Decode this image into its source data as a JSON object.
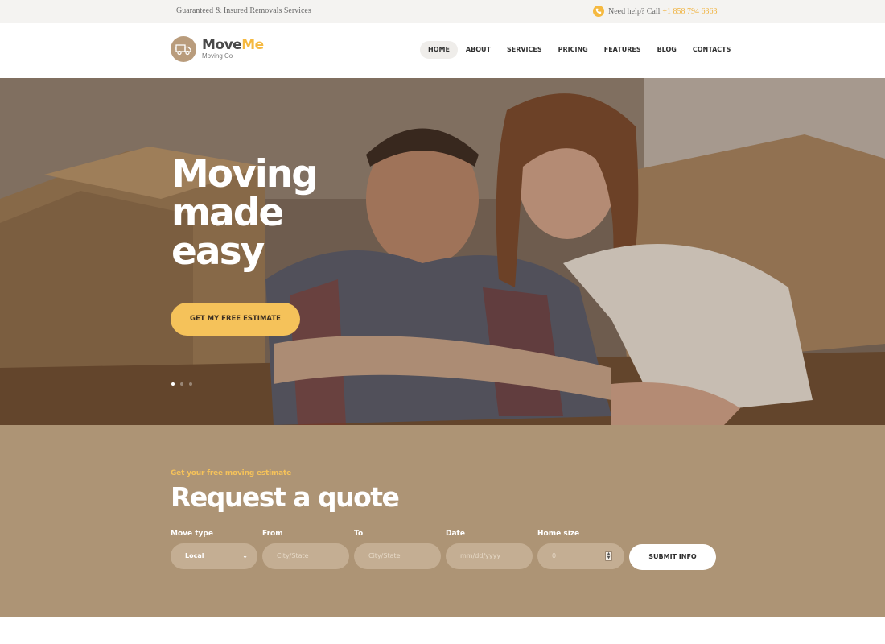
{
  "topbar": {
    "tagline": "Guaranteed & Insured Removals Services",
    "help_label": "Need help? Call",
    "phone": "+1 858 794 6363"
  },
  "brand": {
    "name_part1": "Move",
    "name_part2": "Me",
    "subtitle": "Moving Co"
  },
  "nav": {
    "items": [
      {
        "label": "HOME",
        "active": true
      },
      {
        "label": "ABOUT"
      },
      {
        "label": "SERVICES"
      },
      {
        "label": "PRICING"
      },
      {
        "label": "FEATURES"
      },
      {
        "label": "BLOG"
      },
      {
        "label": "CONTACTS"
      }
    ]
  },
  "hero": {
    "headline_lines": [
      "Moving",
      "made",
      "easy"
    ],
    "cta_label": "GET MY FREE ESTIMATE",
    "slides_count": 3,
    "active_slide": 1
  },
  "quote": {
    "kicker": "Get your free moving estimate",
    "title": "Request a quote",
    "fields": {
      "move_type": {
        "label": "Move type",
        "value": "Local"
      },
      "from": {
        "label": "From",
        "placeholder": "City/State"
      },
      "to": {
        "label": "To",
        "placeholder": "City/State"
      },
      "date": {
        "label": "Date",
        "placeholder": "mm/dd/yyyy"
      },
      "home_size": {
        "label": "Home size",
        "value": "0"
      }
    },
    "submit_label": "SUBMIT INFO"
  },
  "colors": {
    "accent": "#f5c25a",
    "brand_brown": "#ad9475",
    "topbar_bg": "#f4f3f1"
  },
  "icons": {
    "phone": "phone-icon",
    "logo": "moving-truck-icon",
    "select": "chevron-down-icon"
  }
}
